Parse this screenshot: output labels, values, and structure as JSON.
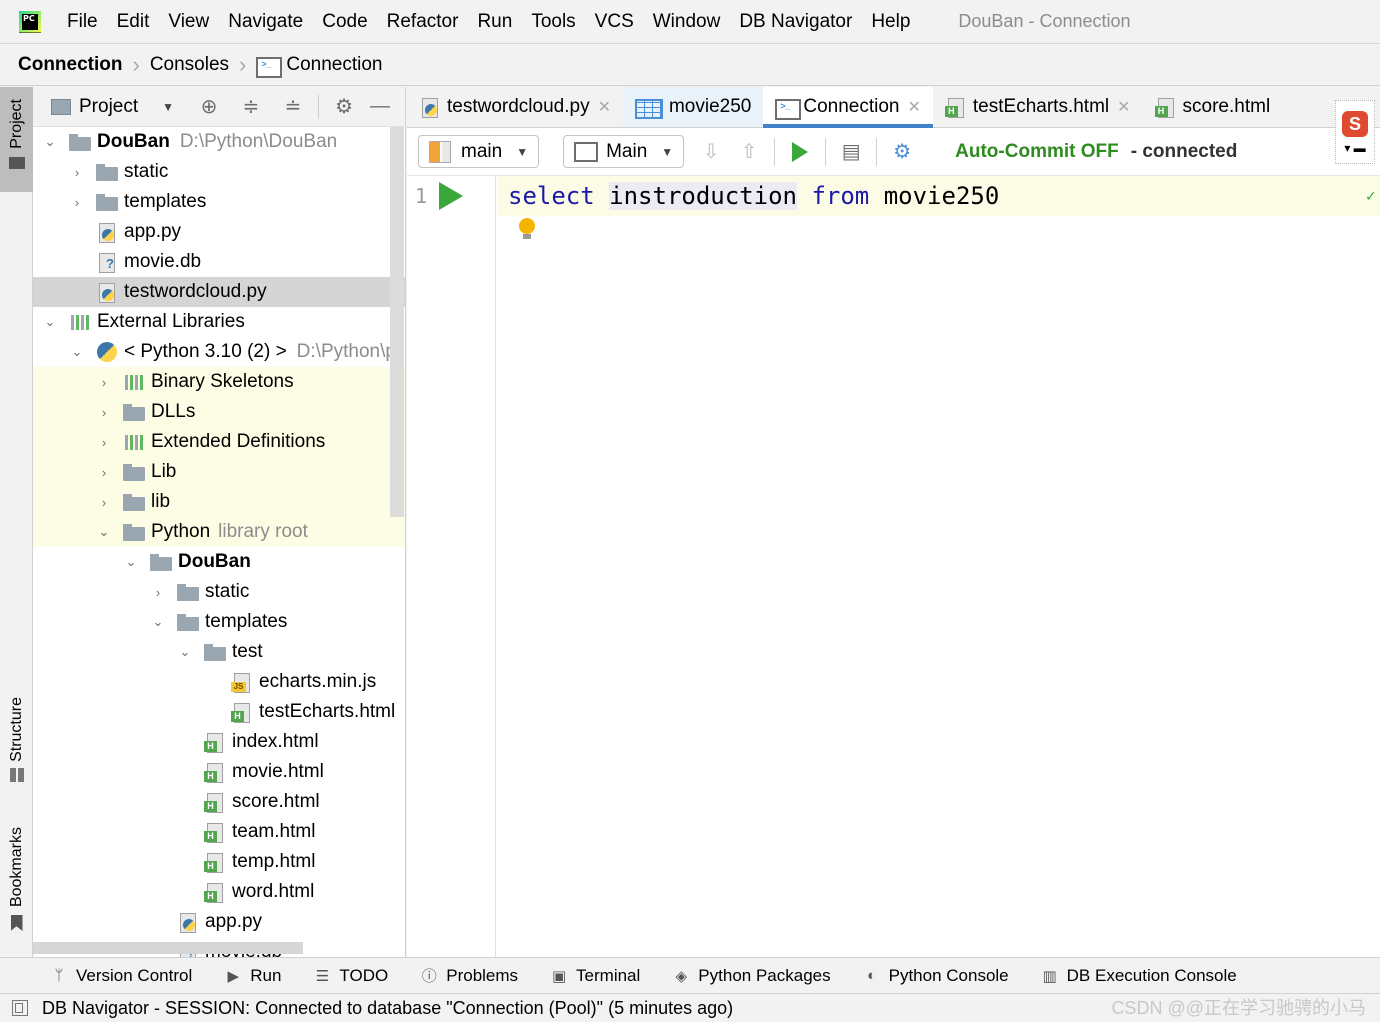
{
  "menubar": {
    "items": [
      "File",
      "Edit",
      "View",
      "Navigate",
      "Code",
      "Refactor",
      "Run",
      "Tools",
      "VCS",
      "Window",
      "DB Navigator",
      "Help"
    ],
    "window_title": "DouBan - Connection",
    "logo_text": "PC"
  },
  "breadcrumb": {
    "root": "Connection",
    "item1": "Consoles",
    "item2": "Connection"
  },
  "left_stripe": {
    "project": "Project",
    "structure": "Structure",
    "bookmarks": "Bookmarks"
  },
  "project_panel": {
    "dropdown_label": "Project",
    "tree": [
      {
        "label": "DouBan",
        "path": "D:\\Python\\DouBan"
      },
      {
        "label": "static"
      },
      {
        "label": "templates"
      },
      {
        "label": "app.py"
      },
      {
        "label": "movie.db"
      },
      {
        "label": "testwordcloud.py"
      },
      {
        "label": "External Libraries"
      },
      {
        "label": "< Python 3.10 (2) >",
        "path": "D:\\Python\\p"
      },
      {
        "label": "Binary Skeletons"
      },
      {
        "label": "DLLs"
      },
      {
        "label": "Extended Definitions"
      },
      {
        "label": "Lib"
      },
      {
        "label": "lib"
      },
      {
        "label": "Python",
        "note": "library root"
      },
      {
        "label": "DouBan"
      },
      {
        "label": "static"
      },
      {
        "label": "templates"
      },
      {
        "label": "test"
      },
      {
        "label": "echarts.min.js"
      },
      {
        "label": "testEcharts.html"
      },
      {
        "label": "index.html"
      },
      {
        "label": "movie.html"
      },
      {
        "label": "score.html"
      },
      {
        "label": "team.html"
      },
      {
        "label": "temp.html"
      },
      {
        "label": "word.html"
      },
      {
        "label": "app.py"
      },
      {
        "label": "movie.db"
      }
    ]
  },
  "editor_tabs": [
    {
      "label": "testwordcloud.py"
    },
    {
      "label": "movie250"
    },
    {
      "label": "Connection"
    },
    {
      "label": "testEcharts.html"
    },
    {
      "label": "score.html"
    }
  ],
  "editor_toolbar": {
    "schema": "main",
    "session": "Main",
    "autocommit": "Auto-Commit OFF",
    "connection_state": "- connected"
  },
  "editor": {
    "line_number": "1",
    "kw_select": "select",
    "identifier": "instroduction",
    "kw_from": "from",
    "table": "movie250"
  },
  "bottom_tools": [
    "Version Control",
    "Run",
    "TODO",
    "Problems",
    "Terminal",
    "Python Packages",
    "Python Console",
    "DB Execution Console"
  ],
  "statusbar": {
    "message": "DB Navigator  - SESSION: Connected to database \"Connection (Pool)\" (5 minutes ago)",
    "watermark": "CSDN @@正在学习驰骋的小马"
  },
  "colors": {
    "accent": "#4083c9",
    "run_green": "#3aa83a",
    "autocommit_green": "#2e8b1f",
    "keyword_blue": "#1a1aa6",
    "library_bg": "#fdfde6"
  }
}
